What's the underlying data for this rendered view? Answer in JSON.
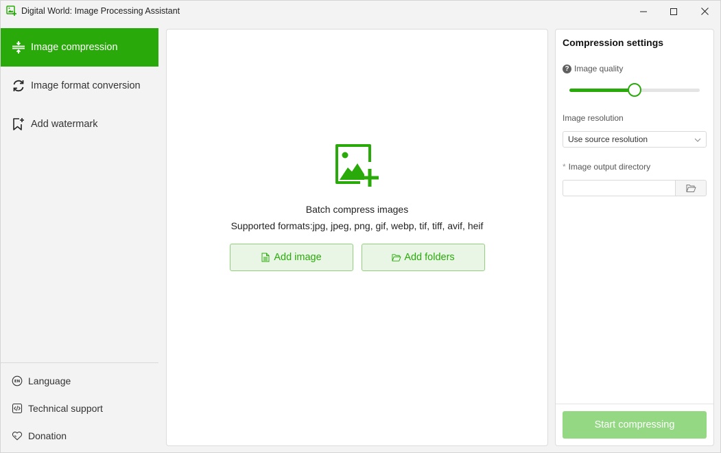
{
  "window": {
    "title": "Digital World: Image Processing Assistant"
  },
  "sidebar": {
    "items": [
      {
        "label": "Image compression",
        "icon": "compress-icon",
        "active": true
      },
      {
        "label": "Image format conversion",
        "icon": "refresh-icon",
        "active": false
      },
      {
        "label": "Add watermark",
        "icon": "bookmark-plus-icon",
        "active": false
      }
    ],
    "footer": [
      {
        "label": "Language",
        "icon": "language-en-icon"
      },
      {
        "label": "Technical support",
        "icon": "code-icon"
      },
      {
        "label": "Donation",
        "icon": "heart-icon"
      }
    ]
  },
  "main": {
    "upload_title": "Batch compress images",
    "supported_formats": "Supported formats:jpg, jpeg, png, gif, webp, tif, tiff, avif, heif",
    "add_image_label": "Add image",
    "add_folders_label": "Add folders"
  },
  "settings": {
    "title": "Compression settings",
    "quality_label": "Image quality",
    "quality_value": 0.5,
    "resolution_label": "Image resolution",
    "resolution_value": "Use source resolution",
    "output_dir_label": "Image output directory",
    "output_dir_value": "",
    "start_label": "Start compressing"
  },
  "colors": {
    "accent": "#2aaa0a",
    "accent_light": "#e9f6e5",
    "accent_disabled": "#94d884"
  }
}
